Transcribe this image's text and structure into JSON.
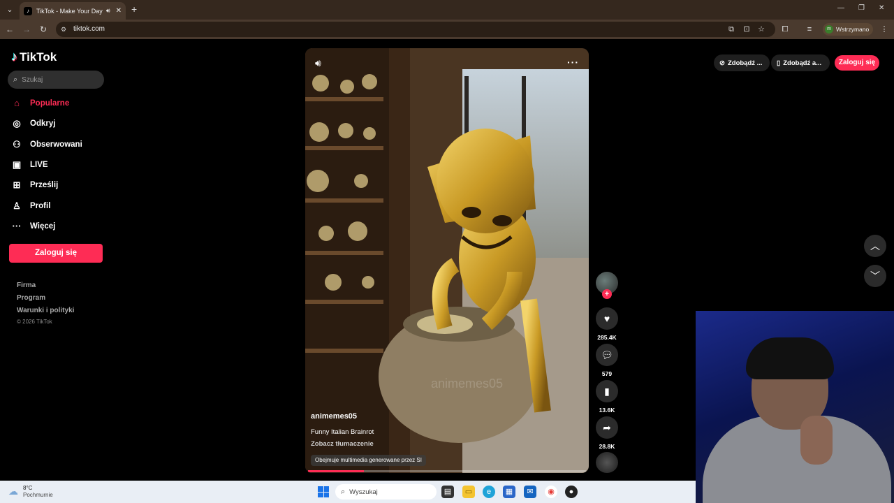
{
  "browser": {
    "tab_title": "TikTok - Make Your Day",
    "tab_icon": "tiktok-icon",
    "url": "tiktok.com",
    "profile_label": "Wstrzymano",
    "profile_initial": "m"
  },
  "sidebar": {
    "logo": "TikTok",
    "search_placeholder": "Szukaj",
    "items": [
      {
        "label": "Popularne",
        "icon": "home-icon",
        "active": true
      },
      {
        "label": "Odkryj",
        "icon": "compass-icon"
      },
      {
        "label": "Obserwowani",
        "icon": "following-icon"
      },
      {
        "label": "LIVE",
        "icon": "live-icon"
      },
      {
        "label": "Prześlij",
        "icon": "upload-icon"
      },
      {
        "label": "Profil",
        "icon": "profile-icon"
      },
      {
        "label": "Więcej",
        "icon": "more-icon"
      }
    ],
    "login_label": "Zaloguj się",
    "footer_links": [
      "Firma",
      "Program",
      "Warunki i polityki"
    ],
    "copyright": "© 2026 TikTok"
  },
  "video": {
    "username": "animemes05",
    "description": "Funny Italian Brainrot",
    "translate_label": "Zobacz tłumaczenie",
    "ai_badge": "Obejmuje multimedia generowane przez SI",
    "watermark": "animemes05",
    "progress": 0.2
  },
  "actions": {
    "likes": "285.4K",
    "comments": "579",
    "saves": "13.6K",
    "shares": "28.8K"
  },
  "header": {
    "get_app_label": "Zdobądź ...",
    "get_app2_label": "Zdobądź a...",
    "login_label": "Zaloguj się"
  },
  "taskbar": {
    "temperature": "8°C",
    "weather_state": "Pochmurnie",
    "search_placeholder": "Wyszukaj"
  },
  "colors": {
    "accent": "#fe2c55",
    "browser_frame": "#4a3a2e"
  }
}
